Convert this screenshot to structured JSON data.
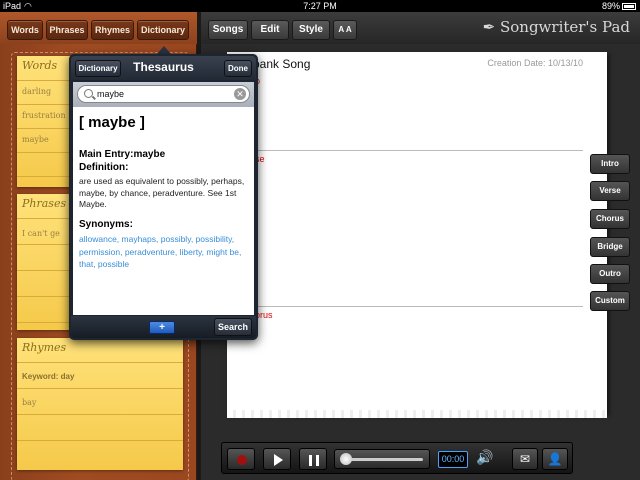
{
  "status": {
    "carrier": "iPad",
    "time": "7:27 PM",
    "battery": "89%"
  },
  "left_tabs": [
    "Words",
    "Phrases",
    "Rhymes",
    "Dictionary"
  ],
  "notes": {
    "words": {
      "header": "Words",
      "items": [
        "darling",
        "frustration",
        "maybe"
      ]
    },
    "phrases": {
      "header": "Phrases",
      "items": [
        "I can't ge"
      ]
    },
    "rhymes": {
      "header": "Rhymes",
      "keyword": "Keyword: day",
      "items": [
        "bay"
      ]
    }
  },
  "toolbar": {
    "songs": "Songs",
    "edit": "Edit",
    "style": "Style",
    "font_size": "A A",
    "brand": "Songwriter's Pad"
  },
  "song": {
    "title": "bank Song",
    "creation_date": "Creation Date: 10/13/10",
    "sections": [
      "o",
      "se",
      "orus"
    ]
  },
  "section_buttons": [
    "Intro",
    "Verse",
    "Chorus",
    "Bridge",
    "Outro",
    "Custom"
  ],
  "player": {
    "time": "00:00",
    "progress": 0
  },
  "thesaurus": {
    "dictionary_button": "Dictionary",
    "title": "Thesaurus",
    "done_button": "Done",
    "search_value": "maybe",
    "headword": "[ maybe ]",
    "main_entry": "Main Entry:maybe",
    "definition_label": "Definition:",
    "definition": "are used as equivalent to possibly, perhaps, maybe, by chance, peradventure. See 1st Maybe.",
    "synonyms_label": "Synonyms:",
    "synonyms": "allowance, mayhaps, possibly, possibility, permission, peradventure, liberty, might be, that, possible",
    "add_button": "+",
    "search_button": "Search"
  }
}
